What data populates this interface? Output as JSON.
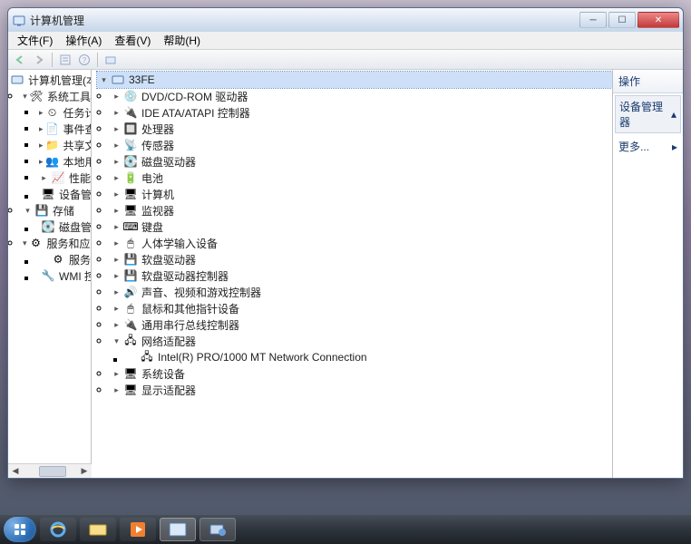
{
  "window": {
    "title": "计算机管理"
  },
  "menu": {
    "file": "文件(F)",
    "action": "操作(A)",
    "view": "查看(V)",
    "help": "帮助(H)"
  },
  "left_tree": {
    "root": "计算机管理(本",
    "sys_tools": "系统工具",
    "task_sched": "任务计划程",
    "event_viewer": "事件查看器",
    "shared": "共享文件夹",
    "local_users": "本地用户和",
    "perf": "性能",
    "dev_mgr": "设备管理器",
    "storage": "存储",
    "disk_mgmt": "磁盘管理",
    "services_apps": "服务和应用程",
    "services": "服务",
    "wmi": "WMI 控件"
  },
  "dev_tree": {
    "root": "33FE",
    "dvd": "DVD/CD-ROM 驱动器",
    "ide": "IDE ATA/ATAPI 控制器",
    "cpu": "处理器",
    "sensors": "传感器",
    "disk_drives": "磁盘驱动器",
    "battery": "电池",
    "computer": "计算机",
    "monitor": "监视器",
    "keyboard": "键盘",
    "hid": "人体学输入设备",
    "floppy": "软盘驱动器",
    "floppy_ctrl": "软盘驱动器控制器",
    "sound": "声音、视频和游戏控制器",
    "mouse": "鼠标和其他指针设备",
    "usb": "通用串行总线控制器",
    "net": "网络适配器",
    "net_child": "Intel(R) PRO/1000 MT Network Connection",
    "sys_dev": "系统设备",
    "display": "显示适配器"
  },
  "right": {
    "header": "操作",
    "section": "设备管理器",
    "more": "更多..."
  }
}
